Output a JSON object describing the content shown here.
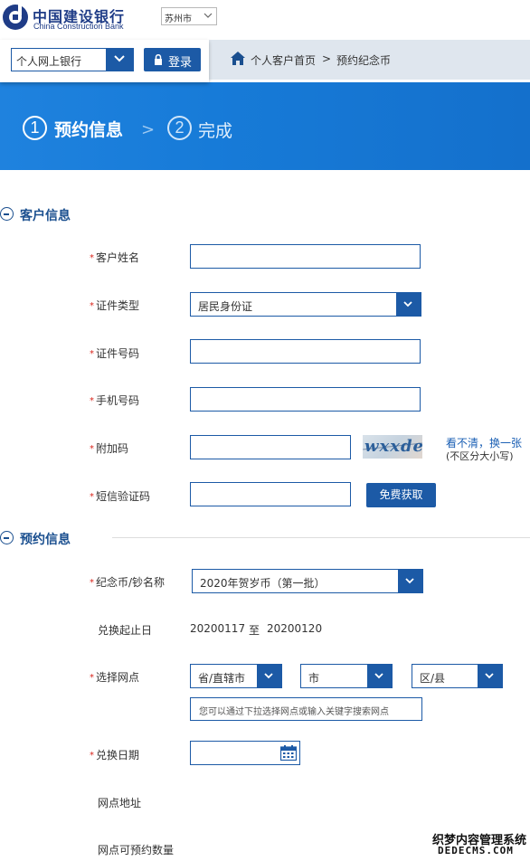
{
  "header": {
    "bank_name_cn": "中国建设银行",
    "bank_name_en": "China Construction Bank",
    "city": "苏州市",
    "brand_color": "#1f3c87"
  },
  "login": {
    "channel": "个人网上银行",
    "login_label": "登录"
  },
  "breadcrumb": {
    "home": "个人客户首页",
    "separator": ">",
    "current": "预约纪念币"
  },
  "steps": [
    {
      "num": "1",
      "label": "预约信息",
      "active": true
    },
    {
      "num": "2",
      "label": "完成",
      "active": false
    }
  ],
  "customer_section": {
    "title": "客户信息",
    "fields": {
      "name_label": "客户姓名",
      "id_type_label": "证件类型",
      "id_type_value": "居民身份证",
      "id_number_label": "证件号码",
      "phone_label": "手机号码",
      "captcha_label": "附加码",
      "captcha_text": "wxxde",
      "captcha_refresh": "看不清，换一张",
      "captcha_case_hint": "(不区分大小写)",
      "sms_label": "短信验证码",
      "sms_button": "免费获取"
    }
  },
  "reservation_section": {
    "title": "预约信息",
    "fields": {
      "coin_label": "纪念币/钞名称",
      "coin_value": "2020年贺岁币（第一批）",
      "period_label": "兑换起止日",
      "period_start": "20200117",
      "period_to": "至",
      "period_end": "20200120",
      "branch_label": "选择网点",
      "province_value": "省/直辖市",
      "city_value": "市",
      "district_value": "区/县",
      "branch_hint": "您可以通过下拉选择网点或输入关键字搜索网点",
      "date_label": "兑换日期",
      "address_label": "网点地址",
      "quota_label": "网点可预约数量"
    }
  },
  "watermark": {
    "line1": "织梦内容管理系统",
    "line2": "DEDECMS.COM"
  },
  "colors": {
    "primary": "#1c5aa6",
    "banner": "#1c79d6",
    "required": "#d9251c"
  }
}
